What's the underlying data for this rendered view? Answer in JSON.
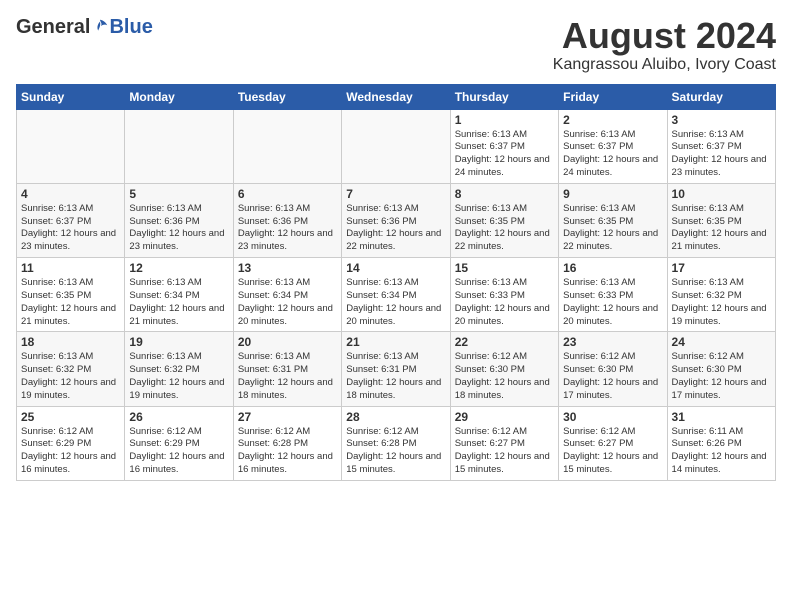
{
  "header": {
    "logo_general": "General",
    "logo_blue": "Blue",
    "month_title": "August 2024",
    "location": "Kangrassou Aluibo, Ivory Coast"
  },
  "weekdays": [
    "Sunday",
    "Monday",
    "Tuesday",
    "Wednesday",
    "Thursday",
    "Friday",
    "Saturday"
  ],
  "weeks": [
    [
      {
        "day": "",
        "info": ""
      },
      {
        "day": "",
        "info": ""
      },
      {
        "day": "",
        "info": ""
      },
      {
        "day": "",
        "info": ""
      },
      {
        "day": "1",
        "info": "Sunrise: 6:13 AM\nSunset: 6:37 PM\nDaylight: 12 hours\nand 24 minutes."
      },
      {
        "day": "2",
        "info": "Sunrise: 6:13 AM\nSunset: 6:37 PM\nDaylight: 12 hours\nand 24 minutes."
      },
      {
        "day": "3",
        "info": "Sunrise: 6:13 AM\nSunset: 6:37 PM\nDaylight: 12 hours\nand 23 minutes."
      }
    ],
    [
      {
        "day": "4",
        "info": "Sunrise: 6:13 AM\nSunset: 6:37 PM\nDaylight: 12 hours\nand 23 minutes."
      },
      {
        "day": "5",
        "info": "Sunrise: 6:13 AM\nSunset: 6:36 PM\nDaylight: 12 hours\nand 23 minutes."
      },
      {
        "day": "6",
        "info": "Sunrise: 6:13 AM\nSunset: 6:36 PM\nDaylight: 12 hours\nand 23 minutes."
      },
      {
        "day": "7",
        "info": "Sunrise: 6:13 AM\nSunset: 6:36 PM\nDaylight: 12 hours\nand 22 minutes."
      },
      {
        "day": "8",
        "info": "Sunrise: 6:13 AM\nSunset: 6:35 PM\nDaylight: 12 hours\nand 22 minutes."
      },
      {
        "day": "9",
        "info": "Sunrise: 6:13 AM\nSunset: 6:35 PM\nDaylight: 12 hours\nand 22 minutes."
      },
      {
        "day": "10",
        "info": "Sunrise: 6:13 AM\nSunset: 6:35 PM\nDaylight: 12 hours\nand 21 minutes."
      }
    ],
    [
      {
        "day": "11",
        "info": "Sunrise: 6:13 AM\nSunset: 6:35 PM\nDaylight: 12 hours\nand 21 minutes."
      },
      {
        "day": "12",
        "info": "Sunrise: 6:13 AM\nSunset: 6:34 PM\nDaylight: 12 hours\nand 21 minutes."
      },
      {
        "day": "13",
        "info": "Sunrise: 6:13 AM\nSunset: 6:34 PM\nDaylight: 12 hours\nand 20 minutes."
      },
      {
        "day": "14",
        "info": "Sunrise: 6:13 AM\nSunset: 6:34 PM\nDaylight: 12 hours\nand 20 minutes."
      },
      {
        "day": "15",
        "info": "Sunrise: 6:13 AM\nSunset: 6:33 PM\nDaylight: 12 hours\nand 20 minutes."
      },
      {
        "day": "16",
        "info": "Sunrise: 6:13 AM\nSunset: 6:33 PM\nDaylight: 12 hours\nand 20 minutes."
      },
      {
        "day": "17",
        "info": "Sunrise: 6:13 AM\nSunset: 6:32 PM\nDaylight: 12 hours\nand 19 minutes."
      }
    ],
    [
      {
        "day": "18",
        "info": "Sunrise: 6:13 AM\nSunset: 6:32 PM\nDaylight: 12 hours\nand 19 minutes."
      },
      {
        "day": "19",
        "info": "Sunrise: 6:13 AM\nSunset: 6:32 PM\nDaylight: 12 hours\nand 19 minutes."
      },
      {
        "day": "20",
        "info": "Sunrise: 6:13 AM\nSunset: 6:31 PM\nDaylight: 12 hours\nand 18 minutes."
      },
      {
        "day": "21",
        "info": "Sunrise: 6:13 AM\nSunset: 6:31 PM\nDaylight: 12 hours\nand 18 minutes."
      },
      {
        "day": "22",
        "info": "Sunrise: 6:12 AM\nSunset: 6:30 PM\nDaylight: 12 hours\nand 18 minutes."
      },
      {
        "day": "23",
        "info": "Sunrise: 6:12 AM\nSunset: 6:30 PM\nDaylight: 12 hours\nand 17 minutes."
      },
      {
        "day": "24",
        "info": "Sunrise: 6:12 AM\nSunset: 6:30 PM\nDaylight: 12 hours\nand 17 minutes."
      }
    ],
    [
      {
        "day": "25",
        "info": "Sunrise: 6:12 AM\nSunset: 6:29 PM\nDaylight: 12 hours\nand 16 minutes."
      },
      {
        "day": "26",
        "info": "Sunrise: 6:12 AM\nSunset: 6:29 PM\nDaylight: 12 hours\nand 16 minutes."
      },
      {
        "day": "27",
        "info": "Sunrise: 6:12 AM\nSunset: 6:28 PM\nDaylight: 12 hours\nand 16 minutes."
      },
      {
        "day": "28",
        "info": "Sunrise: 6:12 AM\nSunset: 6:28 PM\nDaylight: 12 hours\nand 15 minutes."
      },
      {
        "day": "29",
        "info": "Sunrise: 6:12 AM\nSunset: 6:27 PM\nDaylight: 12 hours\nand 15 minutes."
      },
      {
        "day": "30",
        "info": "Sunrise: 6:12 AM\nSunset: 6:27 PM\nDaylight: 12 hours\nand 15 minutes."
      },
      {
        "day": "31",
        "info": "Sunrise: 6:11 AM\nSunset: 6:26 PM\nDaylight: 12 hours\nand 14 minutes."
      }
    ]
  ]
}
